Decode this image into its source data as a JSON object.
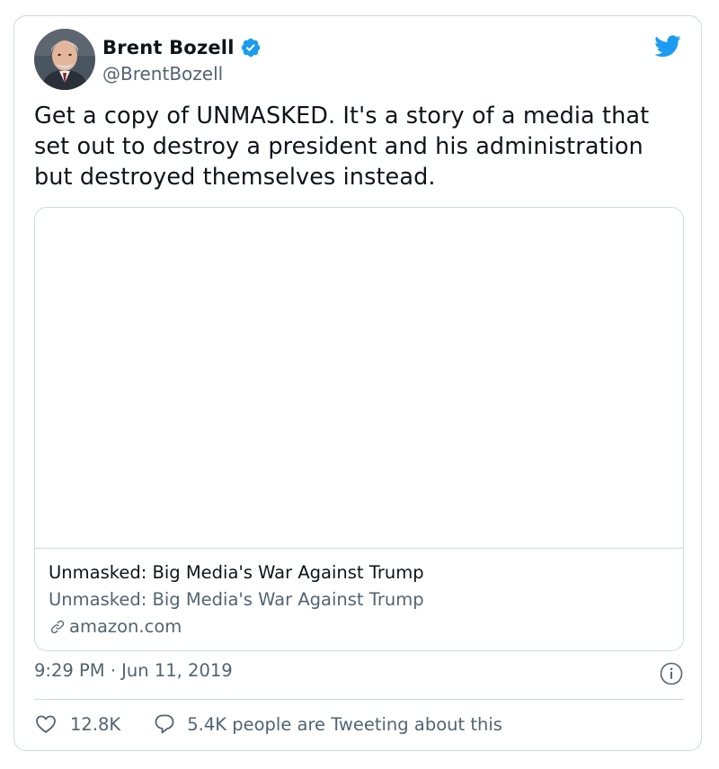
{
  "tweet": {
    "author": {
      "display_name": "Brent Bozell",
      "handle": "@BrentBozell",
      "verified": true
    },
    "text": "Get a copy of UNMASKED. It's a story of a media that set out to destroy a president and his administration but destroyed themselves instead.",
    "link_card": {
      "title": "Unmasked: Big Media's War Against Trump",
      "description": "Unmasked: Big Media's War Against Trump",
      "domain": "amazon.com"
    },
    "timestamp": "9:29 PM · Jun 11, 2019",
    "likes": "12.8K",
    "conversation": "5.4K people are Tweeting about this"
  },
  "icons": {
    "brand": "twitter-bird-icon",
    "verified": "verified-badge-icon",
    "link": "link-icon",
    "info": "info-icon",
    "like": "heart-icon",
    "reply": "speech-bubble-icon"
  },
  "colors": {
    "twitter_blue": "#1d9bf0",
    "text_primary": "#0f1419",
    "text_secondary": "#536471",
    "border": "#cfd9de"
  }
}
